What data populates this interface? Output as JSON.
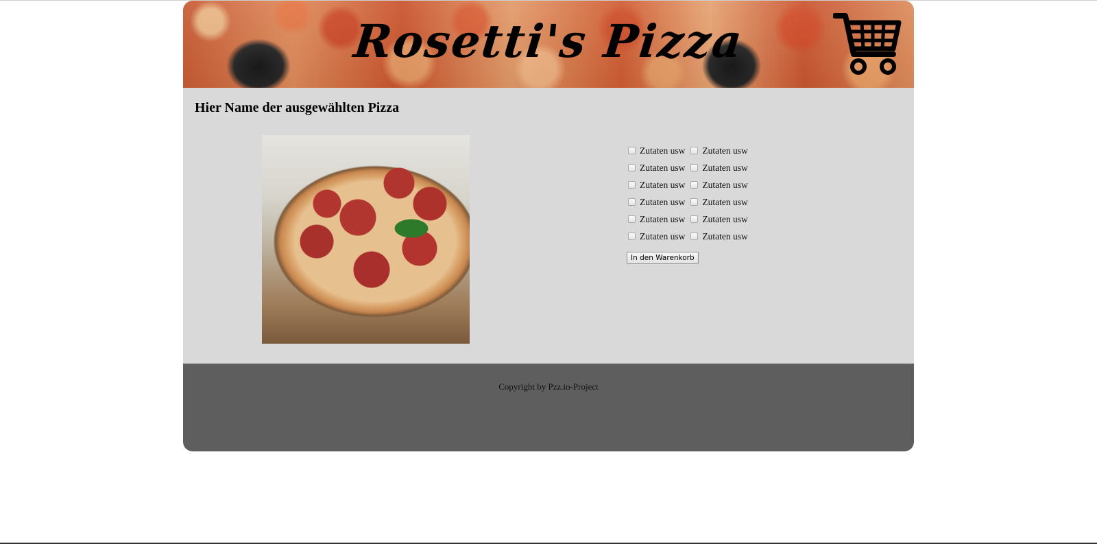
{
  "header": {
    "logo_text": "Rosetti's Pizza",
    "cart_icon": "shopping-cart-icon"
  },
  "main": {
    "pizza_title": "Hier Name der ausgewählten Pizza",
    "pizza_image": "pepperoni-pizza-photo",
    "toppings": [
      [
        "Zutaten usw",
        "Zutaten usw"
      ],
      [
        "Zutaten usw",
        "Zutaten usw"
      ],
      [
        "Zutaten usw",
        "Zutaten usw"
      ],
      [
        "Zutaten usw",
        "Zutaten usw"
      ],
      [
        "Zutaten usw",
        "Zutaten usw"
      ],
      [
        "Zutaten usw",
        "Zutaten usw"
      ]
    ],
    "add_to_cart_label": "In den Warenkorb"
  },
  "footer": {
    "copyright": "Copyright by Pzz.io-Project"
  },
  "colors": {
    "main_bg": "#d9d9d9",
    "footer_bg": "#5e5e5e"
  }
}
